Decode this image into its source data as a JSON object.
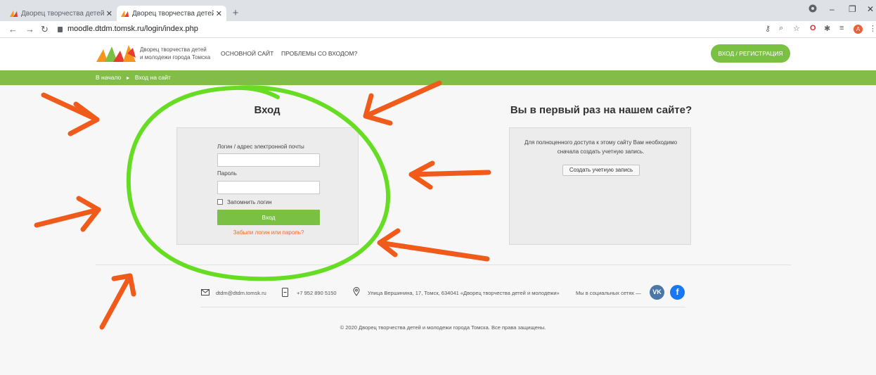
{
  "browser": {
    "tabs": [
      {
        "title": "Дворец творчества детей и мол",
        "active": false
      },
      {
        "title": "Дворец творчества детей и мол",
        "active": true
      }
    ],
    "new_tab": "+",
    "url": "moodle.dtdm.tomsk.ru/login/index.php",
    "window_controls": {
      "minimize": "–",
      "restore": "❐",
      "close": "✕"
    }
  },
  "header": {
    "logo_text_line1": "Дворец творчества детей",
    "logo_text_line2": "и молодежи города Томска",
    "nav": [
      "ОСНОВНОЙ САЙТ",
      "ПРОБЛЕМЫ СО ВХОДОМ?"
    ],
    "cta": "ВХОД / РЕГИСТРАЦИЯ"
  },
  "breadcrumb": {
    "home": "В начало",
    "separator": "►",
    "current": "Вход на сайт"
  },
  "login": {
    "heading": "Вход",
    "username_label": "Логин / адрес электронной почты",
    "username_value": "",
    "password_label": "Пароль",
    "password_value": "",
    "remember_label": "Запомнить логин",
    "remember_checked": false,
    "submit": "Вход",
    "forgot": "Забыли логин или пароль?"
  },
  "signup": {
    "heading": "Вы в первый раз на нашем сайте?",
    "text": "Для полноценного доступа к этому сайту Вам необходимо сначала создать учетную запись.",
    "button": "Создать учетную запись"
  },
  "footer": {
    "email": "dtdm@dtdm.tomsk.ru",
    "phone": "+7 952 890 5150",
    "address": "Улица Вершинина, 17, Томск, 634041 «Дворец творчества детей и молодежи»",
    "social_label": "Мы в социальных сетях —",
    "social": [
      {
        "name": "vk",
        "label": "VK"
      },
      {
        "name": "facebook",
        "label": "f"
      }
    ],
    "copyright": "© 2020 Дворец творчества детей и молодежи города Томска. Все права защищены."
  },
  "colors": {
    "brand_green": "#7ac143",
    "breadcrumb_green": "#82bd48",
    "link_orange": "#ef6c2a",
    "annotation_circle": "#66dd22",
    "annotation_arrows": "#f05a1a",
    "vk": "#4a76a8",
    "facebook": "#1877f2"
  }
}
